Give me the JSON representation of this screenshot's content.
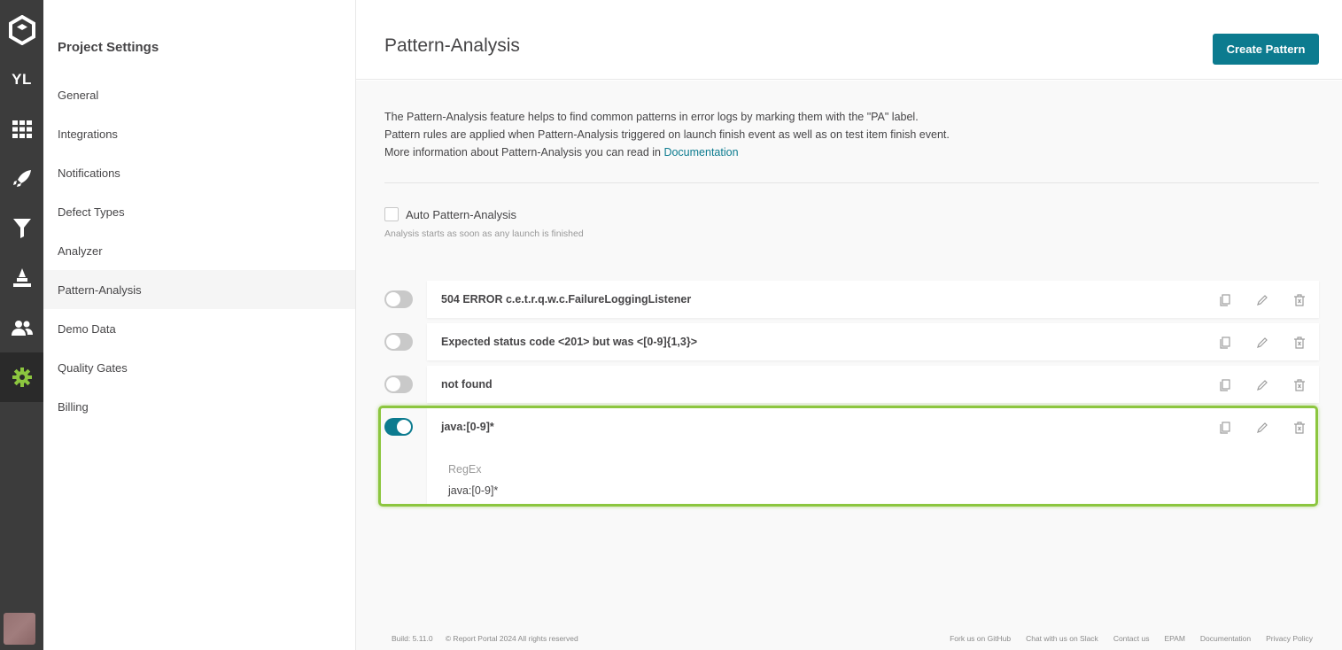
{
  "rail": {
    "avatar_initials": "YL",
    "icons": [
      "logo-icon",
      "dashboard-icon",
      "launches-icon",
      "filters-icon",
      "debug-icon",
      "members-icon",
      "settings-icon"
    ],
    "active_color": "#8cc63f"
  },
  "settings_nav": {
    "title": "Project Settings",
    "items": [
      {
        "label": "General"
      },
      {
        "label": "Integrations"
      },
      {
        "label": "Notifications"
      },
      {
        "label": "Defect Types"
      },
      {
        "label": "Analyzer"
      },
      {
        "label": "Pattern-Analysis"
      },
      {
        "label": "Demo Data"
      },
      {
        "label": "Quality Gates"
      },
      {
        "label": "Billing"
      }
    ],
    "active": "Pattern-Analysis"
  },
  "header": {
    "title": "Pattern-Analysis",
    "create_button": "Create Pattern"
  },
  "description": {
    "text": "The Pattern-Analysis feature helps to find common patterns in error logs by marking them with the \"PA\" label. Pattern rules are applied when Pattern-Analysis triggered on launch finish event as well as on test item finish event. More information about Pattern-Analysis you can read in ",
    "link": "Documentation"
  },
  "auto_pattern": {
    "label": "Auto Pattern-Analysis",
    "checked": false,
    "hint": "Analysis starts as soon as any launch is finished"
  },
  "patterns": [
    {
      "name": "504 ERROR c.e.t.r.q.w.c.FailureLoggingListener",
      "enabled": false
    },
    {
      "name": "Expected status code <201> but was <[0-9]{1,3}>",
      "enabled": false
    },
    {
      "name": "not found",
      "enabled": false
    },
    {
      "name": "java:[0-9]*",
      "enabled": true,
      "expanded": true,
      "type_label": "RegEx",
      "value": "java:[0-9]*"
    }
  ],
  "footer": {
    "build": "Build: 5.11.0",
    "copyright": "© Report Portal 2024 All rights reserved",
    "links": [
      "Fork us on GitHub",
      "Chat with us on Slack",
      "Contact us",
      "EPAM",
      "Documentation",
      "Privacy Policy"
    ]
  },
  "colors": {
    "accent": "#0c7b8f",
    "highlight": "#8cc63f",
    "rail_bg": "#3c3c3c"
  }
}
